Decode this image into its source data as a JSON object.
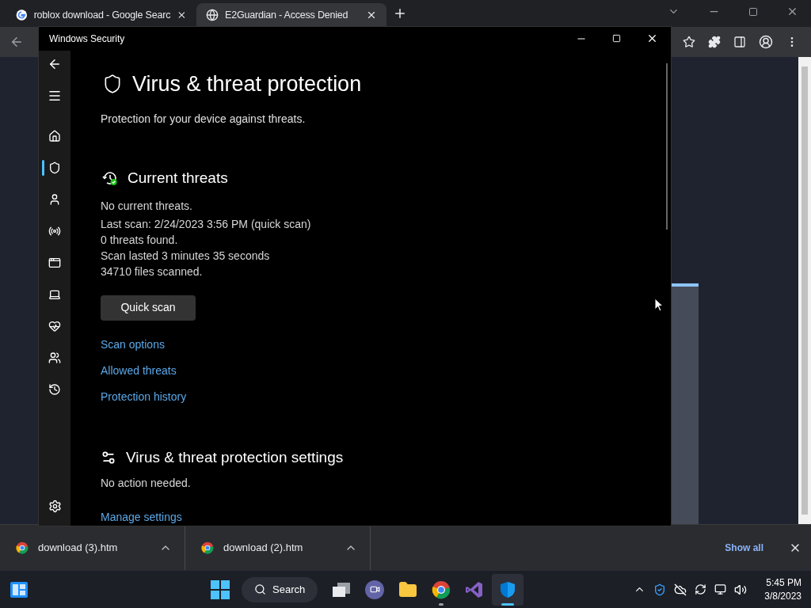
{
  "browser": {
    "tabs": [
      {
        "title": "roblox download - Google Searc",
        "selected": false
      },
      {
        "title": "E2Guardian - Access Denied",
        "selected": true
      }
    ],
    "downloads": [
      {
        "name": "download (3).htm"
      },
      {
        "name": "download (2).htm"
      }
    ],
    "show_all": "Show all"
  },
  "security": {
    "title": "Windows Security",
    "nav": [
      {
        "kind": "home",
        "selected": false
      },
      {
        "kind": "shield",
        "selected": true
      },
      {
        "kind": "account",
        "selected": false
      },
      {
        "kind": "network",
        "selected": false
      },
      {
        "kind": "app",
        "selected": false
      },
      {
        "kind": "device",
        "selected": false
      },
      {
        "kind": "health",
        "selected": false
      },
      {
        "kind": "family",
        "selected": false
      },
      {
        "kind": "history",
        "selected": false
      }
    ],
    "heading": "Virus & threat protection",
    "subtitle": "Protection for your device against threats.",
    "current": {
      "title": "Current threats",
      "lines": [
        "No current threats.",
        "Last scan: 2/24/2023 3:56 PM (quick scan)",
        "0 threats found.",
        "Scan lasted 3 minutes 35 seconds",
        "34710 files scanned."
      ],
      "button": "Quick scan",
      "links": [
        "Scan options",
        "Allowed threats",
        "Protection history"
      ]
    },
    "settings": {
      "title": "Virus & threat protection settings",
      "status": "No action needed.",
      "link": "Manage settings"
    }
  },
  "taskbar": {
    "search": "Search",
    "apps": [
      {
        "kind": "taskview",
        "running": false,
        "selected": false
      },
      {
        "kind": "chat",
        "running": false,
        "selected": false
      },
      {
        "kind": "explorer",
        "running": false,
        "selected": false
      },
      {
        "kind": "chrome",
        "running": true,
        "selected": false
      },
      {
        "kind": "vs",
        "running": false,
        "selected": false
      },
      {
        "kind": "security",
        "running": true,
        "selected": true
      }
    ],
    "time": "5:45 PM",
    "date": "3/8/2023"
  }
}
